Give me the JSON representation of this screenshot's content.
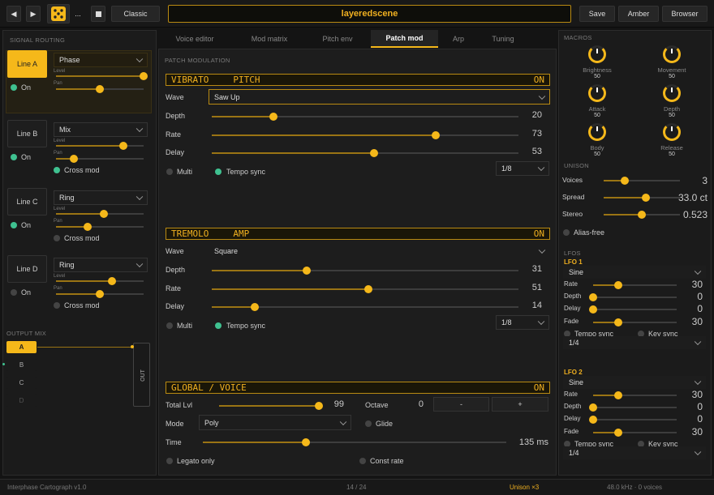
{
  "toolbar": {
    "theme_label": "Classic",
    "preset_name": "layeredscene",
    "more_label": "...",
    "save_label": "Save",
    "amber_label": "Amber",
    "browser_label": "Browser"
  },
  "routing": {
    "title": "SIGNAL ROUTING",
    "lines": [
      {
        "name": "Line A",
        "mode": "Phase",
        "level": 1.0,
        "pan": 0.5,
        "status": "On",
        "status_on": true,
        "cross_mod": null
      },
      {
        "name": "Line B",
        "mode": "Mix",
        "level": 0.77,
        "pan": 0.2,
        "status": "On",
        "status_on": true,
        "cross_mod": "Cross mod",
        "cross_on": true
      },
      {
        "name": "Line C",
        "mode": "Ring",
        "level": 0.55,
        "pan": 0.36,
        "status": "On",
        "status_on": true,
        "cross_mod": "Cross mod",
        "cross_on": false
      },
      {
        "name": "Line D",
        "mode": "Ring",
        "level": 0.64,
        "pan": 0.5,
        "status": "On",
        "status_on": false,
        "cross_mod": "Cross mod",
        "cross_on": false
      }
    ],
    "level_label": "Level",
    "pan_label": "Pan"
  },
  "output_mix": {
    "title": "OUTPUT MIX",
    "buses": [
      "A",
      "B",
      "C",
      "D"
    ],
    "out_label": "OUT"
  },
  "tabs": [
    "Voice editor",
    "Mod matrix",
    "Pitch env",
    "Patch mod",
    "Arp",
    "Tuning"
  ],
  "active_tab": "Patch mod",
  "patch": {
    "title": "PATCH MODULATION",
    "vibrato": {
      "name": "VIBRATO",
      "target": "PITCH",
      "state": "ON",
      "wave_label": "Wave",
      "wave": "Saw Up",
      "rows": [
        {
          "label": "Depth",
          "value": "20",
          "frac": 0.2
        },
        {
          "label": "Rate",
          "value": "73",
          "frac": 0.73
        },
        {
          "label": "Delay",
          "value": "53",
          "frac": 0.53
        }
      ],
      "multi": "Multi",
      "tempo": "Tempo sync",
      "division": "1/8"
    },
    "tremolo": {
      "name": "TREMOLO",
      "target": "AMP",
      "state": "ON",
      "wave_label": "Wave",
      "wave": "Square",
      "rows": [
        {
          "label": "Depth",
          "value": "31",
          "frac": 0.31
        },
        {
          "label": "Rate",
          "value": "51",
          "frac": 0.51
        },
        {
          "label": "Delay",
          "value": "14",
          "frac": 0.14
        }
      ],
      "multi": "Multi",
      "tempo": "Tempo sync",
      "division": "1/8"
    },
    "global": {
      "name": "GLOBAL / VOICE",
      "state": "ON",
      "total_lvl_label": "Total Lvl",
      "total_lvl": "99",
      "total_frac": 0.99,
      "octave_label": "Octave",
      "octave": "0",
      "minus": "-",
      "plus": "+",
      "mode_label": "Mode",
      "mode": "Poly",
      "glide": "Glide",
      "time_label": "Time",
      "time": "135 ms",
      "time_frac": 0.34,
      "legato": "Legato only",
      "const_rate": "Const rate"
    }
  },
  "macros": {
    "title": "MACROS",
    "items": [
      {
        "label": "Brightness",
        "value": "50"
      },
      {
        "label": "Movement",
        "value": "50"
      },
      {
        "label": "Attack",
        "value": "50"
      },
      {
        "label": "Depth",
        "value": "50"
      },
      {
        "label": "Body",
        "value": "50"
      },
      {
        "label": "Release",
        "value": "50"
      }
    ]
  },
  "unison": {
    "title": "UNISON",
    "rows": [
      {
        "label": "Voices",
        "value": "3",
        "frac": 0.28
      },
      {
        "label": "Spread",
        "value": "33.0 ct",
        "frac": 0.55
      },
      {
        "label": "Stereo",
        "value": "0.523",
        "frac": 0.5
      }
    ],
    "alias_free": "Alias-free"
  },
  "lfos": {
    "title": "LFOS",
    "items": [
      {
        "name": "LFO 1",
        "wave": "Sine",
        "rows": [
          {
            "label": "Rate",
            "value": "30",
            "frac": 0.3
          },
          {
            "label": "Depth",
            "value": "0",
            "frac": 0
          },
          {
            "label": "Delay",
            "value": "0",
            "frac": 0
          },
          {
            "label": "Fade",
            "value": "30",
            "frac": 0.3
          }
        ],
        "tempo": "Tempo sync",
        "key": "Key sync",
        "division": "1/4"
      },
      {
        "name": "LFO 2",
        "wave": "Sine",
        "rows": [
          {
            "label": "Rate",
            "value": "30",
            "frac": 0.3
          },
          {
            "label": "Depth",
            "value": "0",
            "frac": 0
          },
          {
            "label": "Delay",
            "value": "0",
            "frac": 0
          },
          {
            "label": "Fade",
            "value": "30",
            "frac": 0.3
          }
        ],
        "tempo": "Tempo sync",
        "key": "Key sync",
        "division": "1/4"
      }
    ]
  },
  "footer": {
    "app": "Interphase Cartograph v1.0",
    "page": "14 / 24",
    "unison": "Unison ×3",
    "status": "48.0 kHz · 0 voices"
  },
  "colors": {
    "accent": "#f5b81a",
    "on": "#3fc190"
  }
}
